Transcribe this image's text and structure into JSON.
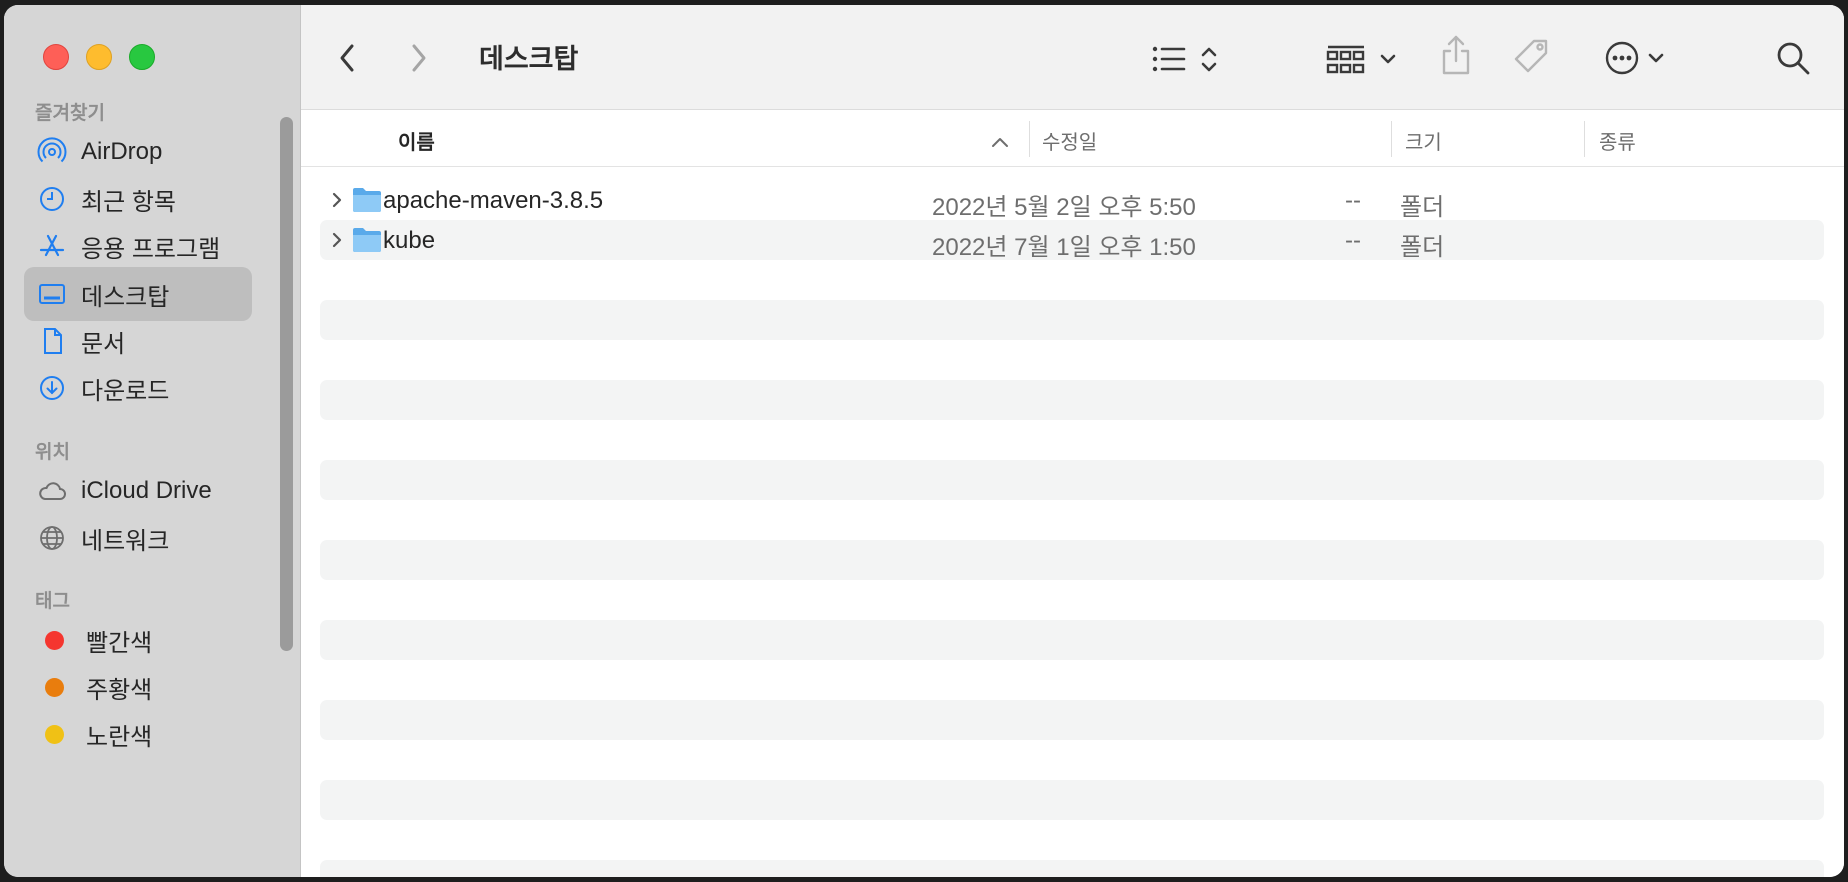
{
  "window": {
    "title": "데스크탑"
  },
  "sidebar": {
    "favorites_header": "즐겨찾기",
    "favorites": [
      {
        "label": "AirDrop",
        "icon": "airdrop-icon"
      },
      {
        "label": "최근 항목",
        "icon": "clock-icon"
      },
      {
        "label": "응용 프로그램",
        "icon": "applications-icon"
      },
      {
        "label": "데스크탑",
        "icon": "desktop-icon",
        "selected": true
      },
      {
        "label": "문서",
        "icon": "document-icon"
      },
      {
        "label": "다운로드",
        "icon": "download-icon"
      }
    ],
    "locations_header": "위치",
    "locations": [
      {
        "label": "iCloud Drive",
        "icon": "cloud-icon"
      },
      {
        "label": "네트워크",
        "icon": "network-globe-icon"
      }
    ],
    "tags_header": "태그",
    "tags": [
      {
        "label": "빨간색",
        "color": "#f5362f"
      },
      {
        "label": "주황색",
        "color": "#e97d0d"
      },
      {
        "label": "노란색",
        "color": "#f0c115"
      }
    ]
  },
  "columns": {
    "name": "이름",
    "modified": "수정일",
    "size": "크기",
    "kind": "종류"
  },
  "files": [
    {
      "name": "apache-maven-3.8.5",
      "modified": "2022년 5월 2일 오후 5:50",
      "size": "--",
      "kind": "폴더"
    },
    {
      "name": "kube",
      "modified": "2022년 7월 1일 오후 1:50",
      "size": "--",
      "kind": "폴더"
    }
  ],
  "colors": {
    "accent": "#1f7ef0",
    "sidebar_bg": "#d6d6d6",
    "selected_bg": "#bebebe",
    "folder_blue": "#6cb7f0"
  }
}
